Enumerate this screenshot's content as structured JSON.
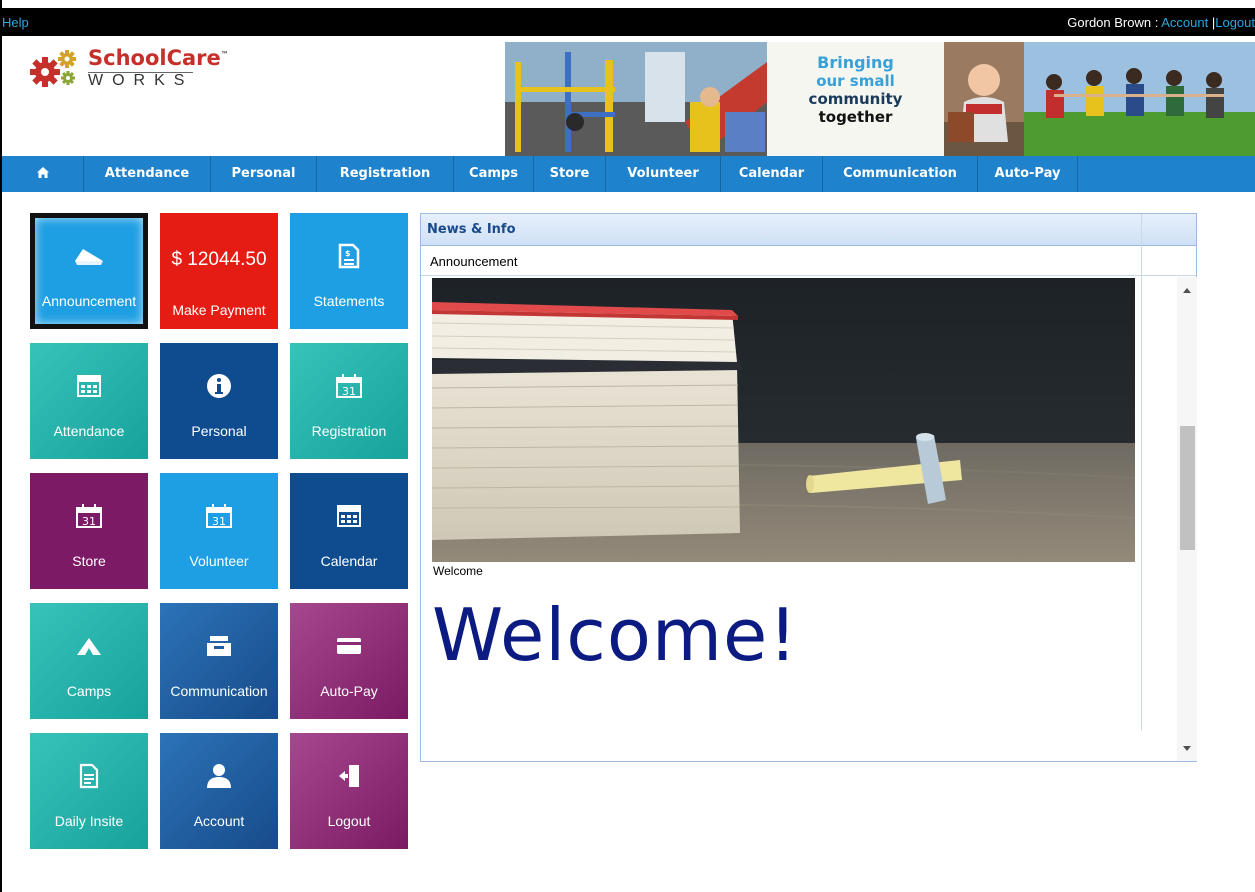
{
  "topbar": {
    "help": "Help",
    "user_name": "Gordon Brown :",
    "account": "Account",
    "sep": "|",
    "logout": "Logout"
  },
  "logo": {
    "brand": "SchoolCare",
    "tm": "™",
    "sub": "WORKS"
  },
  "banner": {
    "line1": "Bringing",
    "line2": "our small",
    "line3": "community",
    "line4": "together"
  },
  "nav": {
    "home_icon": "home-icon",
    "items": [
      "Attendance",
      "Personal",
      "Registration",
      "Camps",
      "Store",
      "Volunteer",
      "Calendar",
      "Communication",
      "Auto-Pay"
    ]
  },
  "tiles": [
    {
      "label": "Announcement",
      "icon": "megaphone-icon",
      "color": "#1e9fe3"
    },
    {
      "label": "Make Payment",
      "amount": "$ 12044.50",
      "color": "#e51c14"
    },
    {
      "label": "Statements",
      "icon": "statement-icon",
      "color": "#1e9fe3"
    },
    {
      "label": "Attendance",
      "icon": "calendar-grid-icon",
      "color": "#1fb0a8"
    },
    {
      "label": "Personal",
      "icon": "info-icon",
      "color": "#0f4c8f"
    },
    {
      "label": "Registration",
      "icon": "calendar-31-icon",
      "color": "#1fb0a8"
    },
    {
      "label": "Store",
      "icon": "calendar-31-icon",
      "color": "#7d1a66"
    },
    {
      "label": "Volunteer",
      "icon": "calendar-31-icon",
      "color": "#1e9fe3"
    },
    {
      "label": "Calendar",
      "icon": "calendar-grid-icon",
      "color": "#0f4c8f"
    },
    {
      "label": "Camps",
      "icon": "tent-icon",
      "color": "#1fb0a8"
    },
    {
      "label": "Communication",
      "icon": "inbox-icon",
      "color": "#1e5d9e"
    },
    {
      "label": "Auto-Pay",
      "icon": "credit-card-icon",
      "color": "#8a2a76"
    },
    {
      "label": "Daily Insite",
      "icon": "document-icon",
      "color": "#1fb0a8"
    },
    {
      "label": "Account",
      "icon": "user-icon",
      "color": "#1e5d9e"
    },
    {
      "label": "Logout",
      "icon": "logout-door-icon",
      "color": "#8a2a76"
    }
  ],
  "news": {
    "title": "News & Info",
    "column": "Announcement",
    "caption": "Welcome",
    "heading": "Welcome!"
  }
}
